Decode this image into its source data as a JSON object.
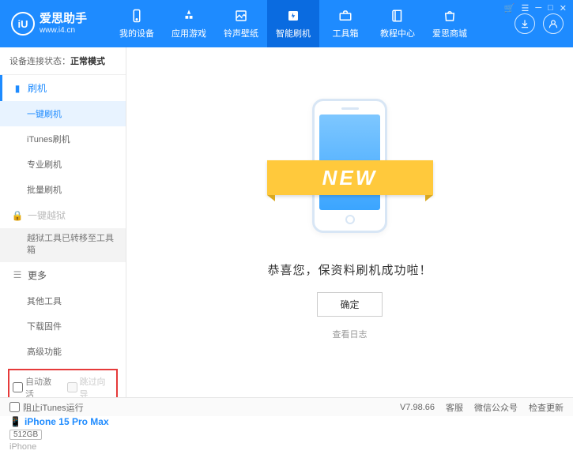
{
  "app": {
    "name": "爱思助手",
    "url": "www.i4.cn"
  },
  "windowControls": [
    "cart",
    "menu",
    "min",
    "max",
    "close"
  ],
  "nav": [
    {
      "label": "我的设备"
    },
    {
      "label": "应用游戏"
    },
    {
      "label": "铃声壁纸"
    },
    {
      "label": "智能刷机",
      "active": true
    },
    {
      "label": "工具箱"
    },
    {
      "label": "教程中心"
    },
    {
      "label": "爱思商城"
    }
  ],
  "connStatus": {
    "prefix": "设备连接状态：",
    "value": "正常模式"
  },
  "sidebar": {
    "flash": {
      "header": "刷机",
      "items": [
        "一键刷机",
        "iTunes刷机",
        "专业刷机",
        "批量刷机"
      ]
    },
    "jailbreak": {
      "header": "一键越狱",
      "note": "越狱工具已转移至工具箱"
    },
    "more": {
      "header": "更多",
      "items": [
        "其他工具",
        "下载固件",
        "高级功能"
      ]
    }
  },
  "checkboxes": {
    "autoActivate": "自动激活",
    "skipGuide": "跳过向导"
  },
  "device": {
    "name": "iPhone 15 Pro Max",
    "storage": "512GB",
    "type": "iPhone"
  },
  "main": {
    "ribbon": "NEW",
    "successText": "恭喜您，保资料刷机成功啦！",
    "okButton": "确定",
    "logLink": "查看日志"
  },
  "footer": {
    "blockItunes": "阻止iTunes运行",
    "version": "V7.98.66",
    "links": [
      "客服",
      "微信公众号",
      "检查更新"
    ]
  }
}
